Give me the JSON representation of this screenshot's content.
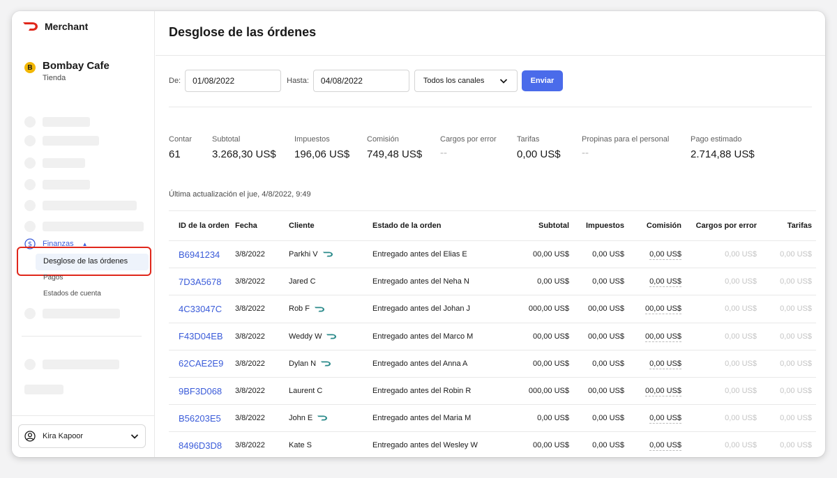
{
  "brand": {
    "name": "Merchant",
    "color": "#e0271b"
  },
  "store": {
    "initial": "B",
    "name": "Bombay Cafe",
    "type": "Tienda"
  },
  "sidebar": {
    "finance_label": "Finanzas",
    "active_item": "Desglose de las órdenes",
    "sub_items": [
      "Pagos",
      "Estados de cuenta"
    ]
  },
  "user": {
    "name": "Kira Kapoor"
  },
  "page": {
    "title": "Desglose de las órdenes"
  },
  "filters": {
    "from_label": "De:",
    "from_value": "01/08/2022",
    "to_label": "Hasta:",
    "to_value": "04/08/2022",
    "channel_value": "Todos los canales",
    "submit_label": "Enviar"
  },
  "summary": [
    {
      "label": "Contar",
      "value": "61"
    },
    {
      "label": "Subtotal",
      "value": "3.268,30 US$"
    },
    {
      "label": "Impuestos",
      "value": "196,06 US$"
    },
    {
      "label": "Comisión",
      "value": "749,48 US$"
    },
    {
      "label": "Cargos por error",
      "value": "--"
    },
    {
      "label": "Tarifas",
      "value": "0,00 US$"
    },
    {
      "label": "Propinas para el personal",
      "value": "--"
    },
    {
      "label": "Pago estimado",
      "value": "2.714,88 US$"
    }
  ],
  "last_updated": "Última actualización el jue, 4/8/2022, 9:49",
  "table": {
    "columns": [
      "ID de la orden",
      "Fecha",
      "Cliente",
      "Estado de la orden",
      "Subtotal",
      "Impuestos",
      "Comisión",
      "Cargos por error",
      "Tarifas"
    ],
    "rows": [
      {
        "id": "B6941234",
        "date": "3/8/2022",
        "customer": "Parkhi V",
        "dasher": true,
        "status": "Entregado antes del Elias E",
        "subtotal": "00,00 US$",
        "tax": "0,00 US$",
        "commission": "0,00 US$",
        "error": "0,00 US$",
        "fees": "0,00 US$"
      },
      {
        "id": "7D3A5678",
        "date": "3/8/2022",
        "customer": "Jared C",
        "dasher": false,
        "status": "Entregado antes del Neha N",
        "subtotal": "0,00 US$",
        "tax": "0,00 US$",
        "commission": "0,00 US$",
        "error": "0,00 US$",
        "fees": "0,00 US$"
      },
      {
        "id": "4C33047C",
        "date": "3/8/2022",
        "customer": "Rob F",
        "dasher": true,
        "status": "Entregado antes del Johan J",
        "subtotal": "000,00 US$",
        "tax": "00,00 US$",
        "commission": "00,00 US$",
        "error": "0,00 US$",
        "fees": "0,00 US$"
      },
      {
        "id": "F43D04EB",
        "date": "3/8/2022",
        "customer": "Weddy W",
        "dasher": true,
        "status": "Entregado antes del Marco M",
        "subtotal": "00,00 US$",
        "tax": "00,00 US$",
        "commission": "00,00 US$",
        "error": "0,00 US$",
        "fees": "0,00 US$"
      },
      {
        "id": "62CAE2E9",
        "date": "3/8/2022",
        "customer": "Dylan N",
        "dasher": true,
        "status": "Entregado antes del Anna A",
        "subtotal": "00,00 US$",
        "tax": "0,00 US$",
        "commission": "0,00 US$",
        "error": "0,00 US$",
        "fees": "0,00 US$"
      },
      {
        "id": "9BF3D068",
        "date": "3/8/2022",
        "customer": "Laurent C",
        "dasher": false,
        "status": "Entregado antes del Robin R",
        "subtotal": "000,00 US$",
        "tax": "00,00 US$",
        "commission": "00,00 US$",
        "error": "0,00 US$",
        "fees": "0,00 US$"
      },
      {
        "id": "B56203E5",
        "date": "3/8/2022",
        "customer": "John E",
        "dasher": true,
        "status": "Entregado antes del Maria M",
        "subtotal": "0,00 US$",
        "tax": "0,00 US$",
        "commission": "0,00 US$",
        "error": "0,00 US$",
        "fees": "0,00 US$"
      },
      {
        "id": "8496D3D8",
        "date": "3/8/2022",
        "customer": "Kate S",
        "dasher": false,
        "status": "Entregado antes del Wesley W",
        "subtotal": "00,00 US$",
        "tax": "0,00 US$",
        "commission": "0,00 US$",
        "error": "0,00 US$",
        "fees": "0,00 US$"
      }
    ]
  },
  "colors": {
    "accent": "#4a6bea",
    "link": "#3a5bd9",
    "highlight": "#e0271b",
    "active_bg": "#eef3fb"
  },
  "icons": {
    "brand": "doordash-logo-icon",
    "finance": "dollar-circle-icon",
    "user": "user-circle-icon",
    "dropdown": "chevron-down-icon",
    "dasher": "dasher-dash-icon"
  }
}
